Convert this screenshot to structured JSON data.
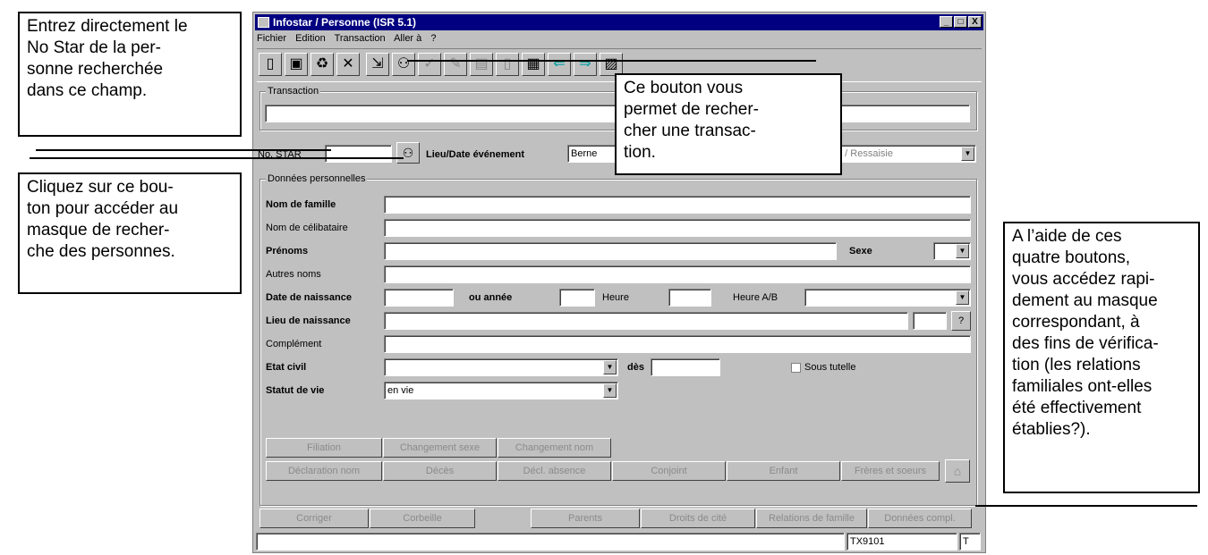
{
  "window": {
    "title": "Infostar / Personne (ISR 5.1)",
    "minimize": "_",
    "maximize": "□",
    "close": "X"
  },
  "menu": [
    "Fichier",
    "Edition",
    "Transaction",
    "Aller à",
    "?"
  ],
  "toolbar_icons": [
    "new-doc-icon",
    "save-icon",
    "recycle-icon",
    "delete-icon",
    "exit-icon",
    "binoculars-icon",
    "check-icon",
    "sign-icon",
    "print-icon",
    "page-icon",
    "preview-icon",
    "left-arrow-icon",
    "right-arrow-icon",
    "help-icon"
  ],
  "transaction": {
    "group_label": "Transaction",
    "value": ""
  },
  "search_row": {
    "no_star_label": "No. STAR",
    "no_star_value": "",
    "lieu_date_label": "Lieu/Date événement",
    "lieu_value": "Berne",
    "mode_value": "e / Ressaisie"
  },
  "personal": {
    "group_label": "Données personnelles",
    "nom_famille": "Nom de famille",
    "nom_celibataire": "Nom de célibataire",
    "prenoms": "Prénoms",
    "sexe": "Sexe",
    "autres_noms": "Autres noms",
    "date_naissance": "Date de naissance",
    "ou_annee": "ou année",
    "heure": "Heure",
    "heure_ab": "Heure A/B",
    "lieu_naissance": "Lieu de naissance",
    "question": "?",
    "complement": "Complément",
    "etat_civil": "Etat civil",
    "des": "dès",
    "sous_tutelle": "Sous tutelle",
    "statut_vie": "Statut de vie",
    "statut_vie_value": "en vie"
  },
  "inner_buttons_row1": [
    "Filiation",
    "Changement sexe",
    "Changement nom"
  ],
  "inner_buttons_row2": [
    "Déclaration nom",
    "Décès",
    "Décl. absence",
    "Conjoint",
    "Enfant",
    "Frères et soeurs"
  ],
  "bottom_buttons": [
    "Corriger",
    "Corbeille",
    "Parents",
    "Droits de cité",
    "Relations de famille",
    "Données compl."
  ],
  "status": {
    "message": "",
    "code": "TX9101",
    "flag": "T"
  },
  "callouts": {
    "no_star": "Entrez directement le\nNo Star de la per-\nsonne recherchée\ndans ce champ.",
    "search_btn": "Cliquez sur ce bou-\nton pour accéder au\nmasque de recher-\nche des personnes.",
    "transaction_btn": "Ce bouton vous\npermet de recher-\ncher une transac-\ntion.",
    "four_buttons": "A l’aide de ces\nquatre boutons,\nvous accédez rapi-\ndement au masque\ncorrespondant, à\ndes fins de vérifica-\ntion (les relations\nfamiliales ont-elles\nété effectivement\nétablies?)."
  }
}
